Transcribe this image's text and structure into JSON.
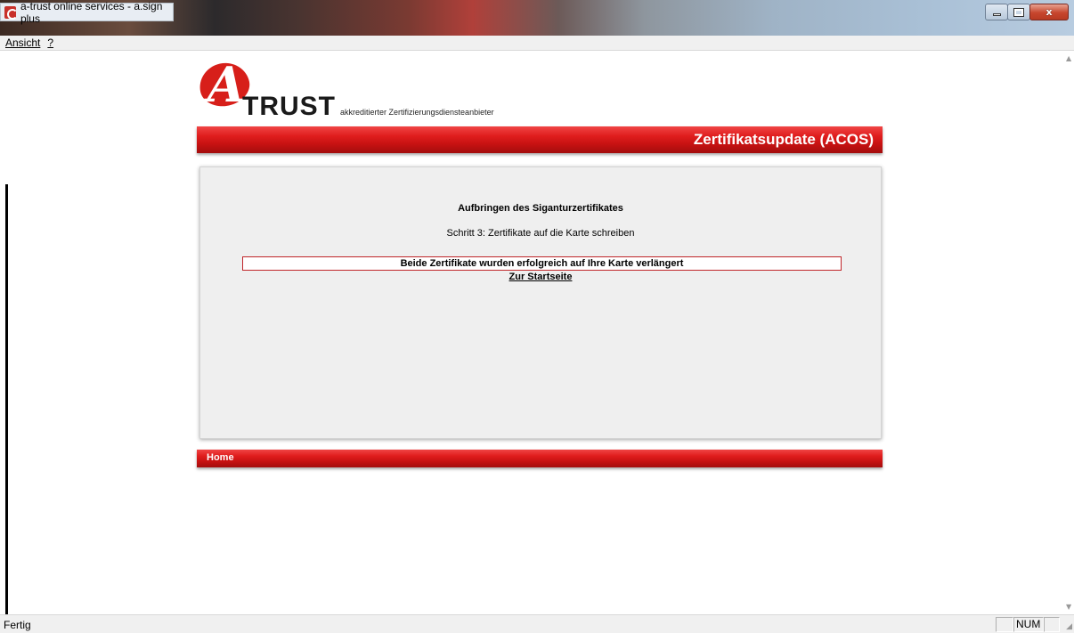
{
  "window": {
    "title": "a-trust online services - a.sign plus",
    "controls": {
      "minimize": "",
      "maximize": "",
      "close": "x"
    }
  },
  "menu": [
    {
      "label": "Ansicht"
    },
    {
      "label": "?"
    }
  ],
  "logo": {
    "mark": "A",
    "brand": "TRUST",
    "tagline": "akkreditierter Zertifizierungsdiensteanbieter"
  },
  "header": {
    "title": "Zertifikatsupdate (ACOS)"
  },
  "panel": {
    "heading": "Aufbringen des Siganturzertifikates",
    "step": "Schritt 3: Zertifikate auf die Karte schreiben",
    "success_message": "Beide Zertifikate wurden erfolgreich auf Ihre Karte verlängert",
    "start_link": "Zur Startseite"
  },
  "footer": {
    "home_label": "Home"
  },
  "statusbar": {
    "text": "Fertig",
    "num_indicator": "NUM"
  },
  "colors": {
    "brand_red": "#d71f1a",
    "panel_bg": "#efefef",
    "success_border": "#c0262a"
  }
}
